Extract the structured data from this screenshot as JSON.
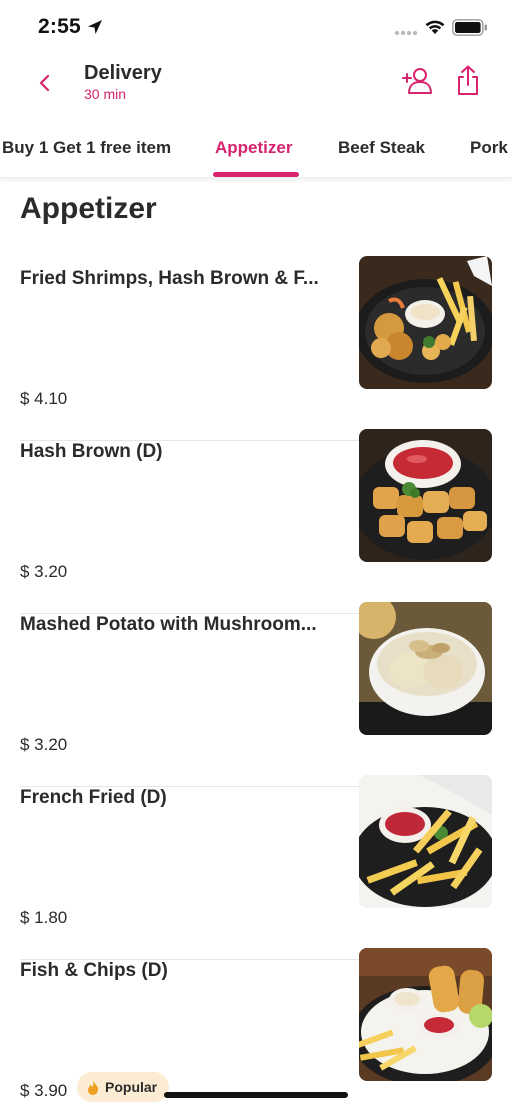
{
  "status_bar": {
    "time": "2:55"
  },
  "header": {
    "title": "Delivery",
    "subtitle": "30 min"
  },
  "tabs": [
    {
      "label": "Buy 1 Get 1 free item",
      "active": false
    },
    {
      "label": "Appetizer",
      "active": true
    },
    {
      "label": "Beef Steak",
      "active": false
    },
    {
      "label": "Pork",
      "active": false
    }
  ],
  "section": {
    "title": "Appetizer"
  },
  "items": [
    {
      "name": "Fried Shrimps, Hash Brown & F...",
      "price": "$ 4.10"
    },
    {
      "name": "Hash Brown (D)",
      "price": "$ 3.20"
    },
    {
      "name": "Mashed Potato with Mushroom...",
      "price": "$ 3.20"
    },
    {
      "name": "French Fried (D)",
      "price": "$ 1.80"
    },
    {
      "name": "Fish & Chips (D)",
      "price": "$ 3.90",
      "badge": "Popular"
    }
  ],
  "colors": {
    "accent": "#d6246e",
    "badge_bg": "#fcecd4",
    "text": "#2b2b2b"
  },
  "icons": [
    "location-arrow-icon",
    "wifi-icon",
    "battery-icon",
    "back-chevron-icon",
    "group-order-icon",
    "share-icon",
    "flame-icon"
  ]
}
